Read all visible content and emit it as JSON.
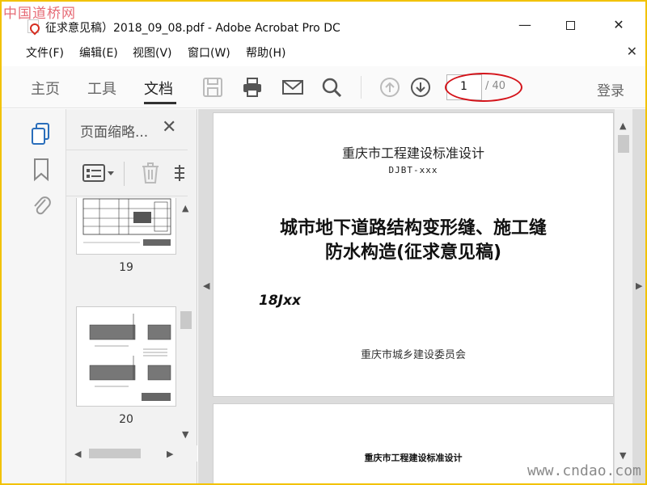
{
  "watermark_top": "中国道桥网",
  "watermark_bottom": "www.cndao.com",
  "window": {
    "title": "征求意见稿）2018_09_08.pdf - Adobe Acrobat Pro DC",
    "controls": {
      "minimize": "—",
      "close": "✕"
    }
  },
  "menu": {
    "items": [
      "文件(F)",
      "编辑(E)",
      "视图(V)",
      "窗口(W)",
      "帮助(H)"
    ],
    "close": "✕"
  },
  "toolbar": {
    "tabs": [
      "主页",
      "工具",
      "文档"
    ],
    "active_tab": "文档",
    "icons": [
      "save-icon",
      "print-icon",
      "mail-icon",
      "search-icon",
      "page-up-icon",
      "page-down-icon"
    ],
    "current_page": "1",
    "total_pages": "/ 40",
    "login": "登录",
    "annotation_color": "#d4131a"
  },
  "sidebar": {
    "rail_icons": [
      "page-thumbnails-icon",
      "bookmark-icon",
      "attachment-icon"
    ],
    "panel_title": "页面缩略...",
    "panel_close": "✕",
    "thumbnails": [
      {
        "label": "19"
      },
      {
        "label": "20"
      }
    ]
  },
  "document": {
    "page1": {
      "org": "重庆市工程建设标准设计",
      "code": "DJBT-xxx",
      "title_line1": "城市地下道路结构变形缝、施工缝",
      "title_line2": "防水构造(征求意见稿)",
      "number": "18Jxx",
      "issuer": "重庆市城乡建设委员会"
    },
    "page2": {
      "org": "重庆市工程建设标准设计"
    }
  },
  "colors": {
    "frame_border": "#f2c200",
    "accent_blue": "#2a6ebb"
  }
}
